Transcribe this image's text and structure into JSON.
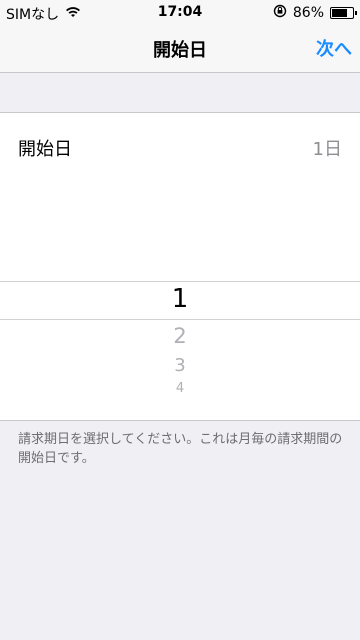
{
  "status": {
    "carrier": "SIMなし",
    "time": "17:04",
    "battery": "86%",
    "battery_level": 0.86,
    "wifi_icon": "wifi-icon",
    "rotation_lock_icon": "rotation-lock-icon"
  },
  "nav": {
    "title": "開始日",
    "next_label": "次へ"
  },
  "setting": {
    "label": "開始日",
    "value": "1日"
  },
  "picker": {
    "items": [
      "1",
      "2",
      "3",
      "4"
    ],
    "selected_index": 0
  },
  "footer": {
    "note": "請求期日を選択してください。これは月毎の請求期間の開始日です。"
  },
  "colors": {
    "accent": "#1a8cff",
    "background": "#efeff4"
  }
}
